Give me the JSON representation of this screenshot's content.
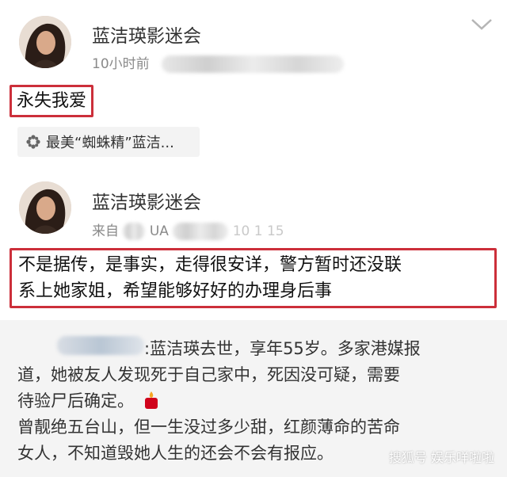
{
  "post1": {
    "author": "蓝洁瑛影迷会",
    "time": "10小时前",
    "content": "永失我爱",
    "topic_icon": "pinwheel-icon",
    "topic_label": "最美“蜘蛛精”蓝洁..."
  },
  "post2": {
    "author": "蓝洁瑛影迷会",
    "source_prefix": "来自",
    "source_fragment_a": "UA",
    "source_fragment_b": "10 1 15",
    "content_line1": "不是据传，是事实，走得很安详，警方暂时还没联",
    "content_line2": "系上她家姐，希望能够好好的办理身后事"
  },
  "quoted": {
    "line1": ":蓝洁瑛去世，享年55岁。多家港媒报",
    "line2": "道，她被友人发现死于自己家中，死因没可疑，需要",
    "line3": "待验尸后确定。",
    "candle_icon": "candle-icon",
    "line4": "曾靓绝五台山，但一生没过多少甜，红颜薄命的苦命",
    "line5": "女人，不知道毁她人生的还会不会有报应。"
  },
  "watermark": "搜狐号 娱乐咩啦啦",
  "colors": {
    "highlight_border": "#cc2f3a",
    "quote_bg": "#f4f4f4",
    "meta_gray": "#8a8a8a"
  }
}
